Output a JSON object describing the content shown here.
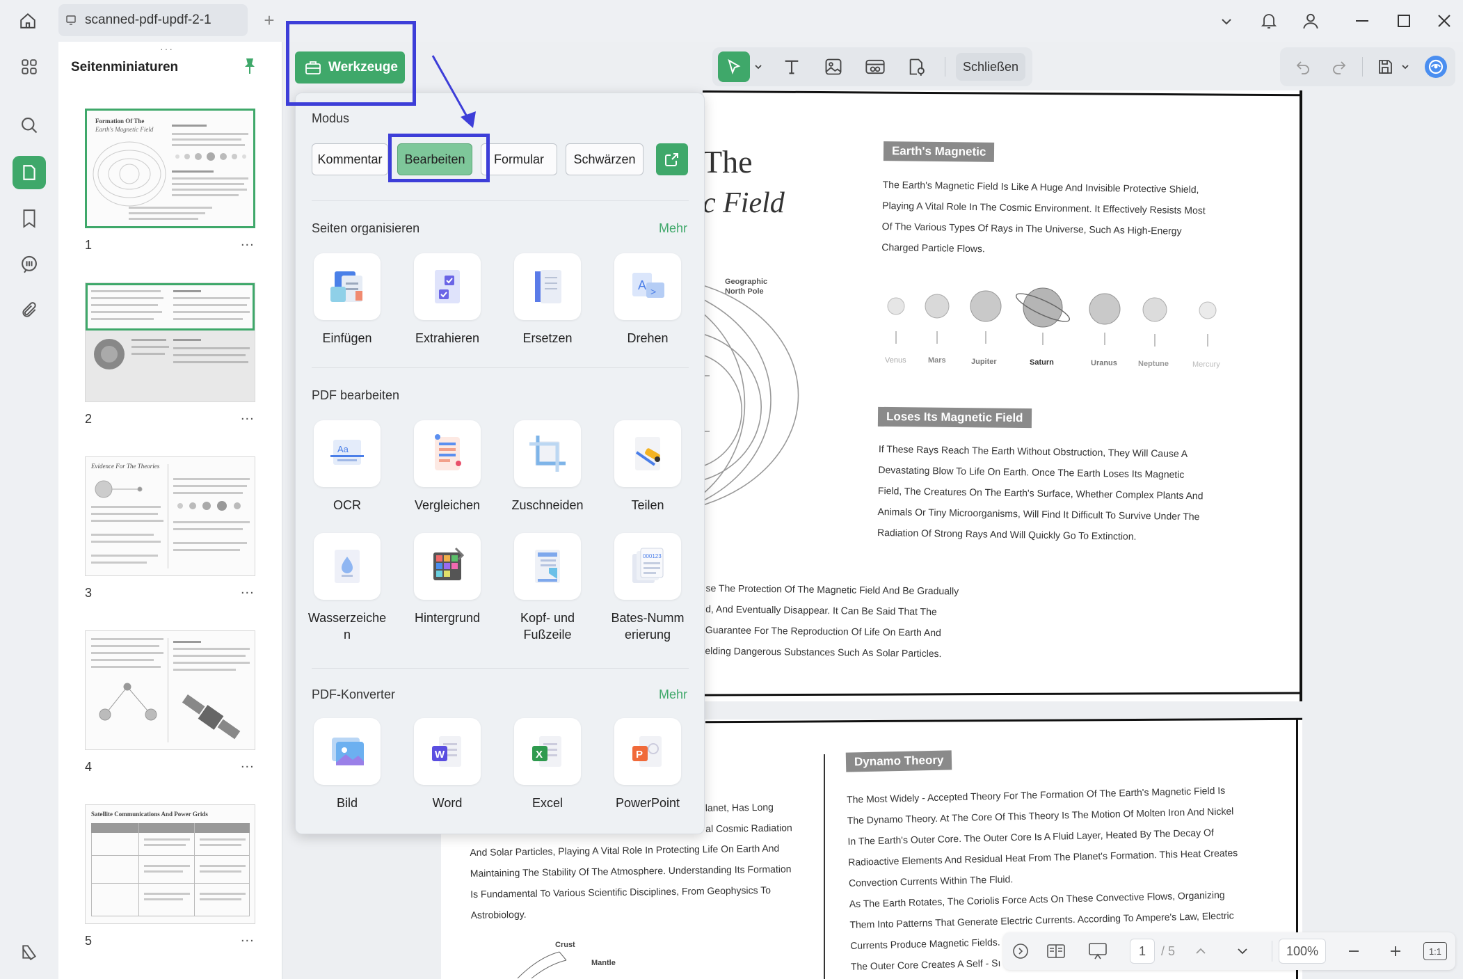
{
  "window": {
    "tab_title": "scanned-pdf-updf-2-1"
  },
  "left_panel": {
    "title": "Seitenminiaturen",
    "thumbnails": [
      {
        "number": "1",
        "heading": "Formation Of The",
        "subheading": "Earth's Magnetic Field"
      },
      {
        "number": "2"
      },
      {
        "number": "3",
        "heading": "Evidence For The Theories"
      },
      {
        "number": "4"
      },
      {
        "number": "5",
        "heading": "Satellite Communications And Power Grids"
      }
    ],
    "more_label": "..."
  },
  "toolbar": {
    "tools_label": "Werkzeuge",
    "close_label": "Schließen"
  },
  "popup": {
    "mode_title": "Modus",
    "modes": [
      "Kommentar",
      "Bearbeiten",
      "Formular",
      "Schwärzen"
    ],
    "organize": {
      "title": "Seiten organisieren",
      "more": "Mehr",
      "items": [
        "Einfügen",
        "Extrahieren",
        "Ersetzen",
        "Drehen"
      ]
    },
    "edit": {
      "title": "PDF bearbeiten",
      "items": [
        "OCR",
        "Vergleichen",
        "Zuschneiden",
        "Teilen",
        "Wasserzeichen",
        "Hintergrund",
        "Kopf- und Fußzeile",
        "Bates-Nummerierung"
      ],
      "wrapped": [
        "Wasserzeiche",
        "n",
        "Kopf- und",
        "Fußzeile",
        "Bates-Numm",
        "erierung"
      ]
    },
    "converter": {
      "title": "PDF-Konverter",
      "more": "Mehr",
      "items": [
        "Bild",
        "Word",
        "Excel",
        "PowerPoint"
      ]
    }
  },
  "document": {
    "page1": {
      "title_part1": "The",
      "title_part2": "c Field",
      "tag1": "Earth's Magnetic",
      "para1": [
        "The Earth's Magnetic Field Is Like A Huge And Invisible Protective Shield,",
        "Playing A Vital Role In The Cosmic Environment. It Effectively Resists Most",
        "Of The Various Types Of Rays in The Universe, Such As High-Energy",
        "Charged Particle Flows."
      ],
      "pole_label": [
        "Geographic",
        "North Pole"
      ],
      "planets": [
        "Venus",
        "Mars",
        "Jupiter",
        "Saturn",
        "Uranus",
        "Neptune",
        "Mercury"
      ],
      "tag2": "Loses Its Magnetic Field",
      "para2": [
        "If These Rays Reach The Earth Without Obstruction, They Will Cause A",
        "Devastating Blow To Life On Earth. Once The Earth Loses Its Magnetic",
        "Field, The Creatures On The Earth's Surface, Whether Complex Plants And",
        "Animals Or Tiny Microorganisms, Will Find It Difficult To Survive Under The",
        "Radiation Of Strong Rays And Will Quickly Go To Extinction."
      ],
      "para3": [
        "se The Protection Of The Magnetic Field And Be Gradually",
        "d, And Eventually Disappear. It Can Be Said That The",
        "Guarantee For The Reproduction Of Life On Earth And",
        "elding Dangerous Substances Such As Solar Particles."
      ]
    },
    "page2": {
      "left_para": [
        "lanet, Has Long",
        "al Cosmic Radiation",
        "And Solar Particles, Playing A Vital Role In Protecting Life On Earth And",
        "Maintaining The Stability Of The Atmosphere. Understanding Its Formation",
        "Is Fundamental To Various Scientific Disciplines, From Geophysics To",
        "Astrobiology."
      ],
      "diagram_labels": [
        "Crust",
        "Mantle"
      ],
      "tag": "Dynamo Theory",
      "right_para": [
        "The Most Widely - Accepted Theory For The Formation Of The Earth's Magnetic Field Is",
        "The Dynamo Theory. At The Core Of This Theory Is The Motion Of Molten Iron And Nickel",
        "In The Earth's Outer Core. The Outer Core Is A Fluid Layer, Heated By The Decay Of",
        "Radioactive Elements And Residual Heat From The Planet's Formation. This Heat Creates",
        "Convection Currents Within The Fluid.",
        "As The Earth Rotates, The Coriolis Force Acts On These Convective Flows, Organizing",
        "Them Into Patterns That Generate Electric Currents. According To Ampere's Law, Electric",
        "Currents Produce Magnetic Fields.",
        "The Outer Core Creates A Self - Sı"
      ]
    }
  },
  "bottombar": {
    "page_current": "1",
    "page_total": "/ 5",
    "zoom": "100%",
    "fit_label": "1:1"
  },
  "colors": {
    "accent": "#3fa86a",
    "highlight": "#3d3ed8"
  }
}
